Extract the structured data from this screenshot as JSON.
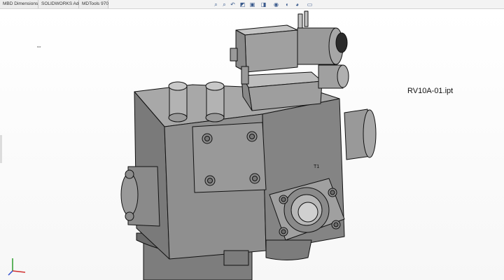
{
  "tabs": [
    {
      "label": "MBD Dimensions"
    },
    {
      "label": "SOLIDWORKS Add-Ins"
    },
    {
      "label": "MDTools 970"
    }
  ],
  "heads_up_toolbar": [
    {
      "icon": "zoom-to-fit-icon"
    },
    {
      "icon": "zoom-to-area-icon"
    },
    {
      "icon": "previous-view-icon"
    },
    {
      "icon": "section-view-icon"
    },
    {
      "icon": "view-orientation-icon"
    },
    {
      "icon": "display-style-icon"
    },
    {
      "icon": "hide-show-items-icon"
    },
    {
      "icon": "edit-appearance-icon"
    },
    {
      "icon": "apply-scene-icon"
    },
    {
      "icon": "view-settings-icon"
    }
  ],
  "viewport": {
    "model_label": "RV10A-01.ipt",
    "part_mark": "T1"
  },
  "colors": {
    "body_front": "#8c8c8c",
    "body_top": "#a9a9a9",
    "body_side": "#6e6e6e",
    "edge": "#111111"
  }
}
